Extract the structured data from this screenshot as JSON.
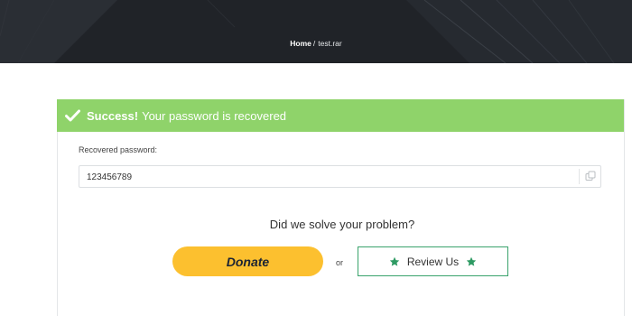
{
  "breadcrumb": {
    "home": "Home",
    "separator": "/",
    "current": "test.rar"
  },
  "alert": {
    "strong": "Success!",
    "message": "Your password is recovered",
    "icon": "check-icon",
    "color": "#8fd36a"
  },
  "recovered": {
    "label": "Recovered password:",
    "value": "123456789",
    "copy_icon": "copy-icon"
  },
  "feedback": {
    "question": "Did we solve your problem?",
    "donate_label": "Donate",
    "or_text": "or",
    "review_label": "Review Us",
    "star_icon": "star-icon",
    "donate_color": "#fcc02f",
    "review_border_color": "#3aa36c"
  }
}
